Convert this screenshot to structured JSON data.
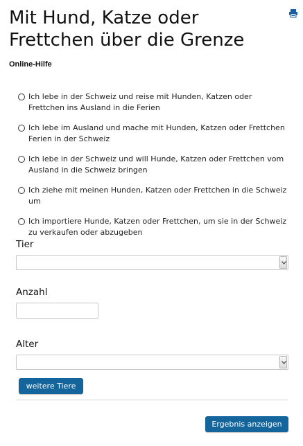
{
  "page": {
    "title": "Mit Hund, Katze oder Frettchen über die Grenze",
    "subtitle": "Online-Hilfe",
    "print_icon": "print-icon"
  },
  "options": [
    "Ich lebe in der Schweiz und reise mit Hunden, Katzen oder Frettchen ins Ausland in die Ferien",
    "Ich lebe im Ausland und mache mit Hunden, Katzen oder Frettchen Ferien in der Schweiz",
    "Ich lebe in der Schweiz und will Hunde, Katzen oder Frettchen vom Ausland in die Schweiz bringen",
    "Ich ziehe mit meinen Hunden, Katzen oder Frettchen in die Schweiz um",
    "Ich importiere Hunde, Katzen oder Frettchen, um sie in der Schweiz zu verkaufen oder abzugeben"
  ],
  "form": {
    "tier_label": "Tier",
    "tier_value": "",
    "anzahl_label": "Anzahl",
    "anzahl_value": "",
    "alter_label": "Alter",
    "alter_value": "",
    "more_animals_button": "weitere Tiere",
    "result_button": "Ergebnis anzeigen"
  },
  "colors": {
    "button": "#13659c",
    "print_icon": "#1a5fa0"
  }
}
